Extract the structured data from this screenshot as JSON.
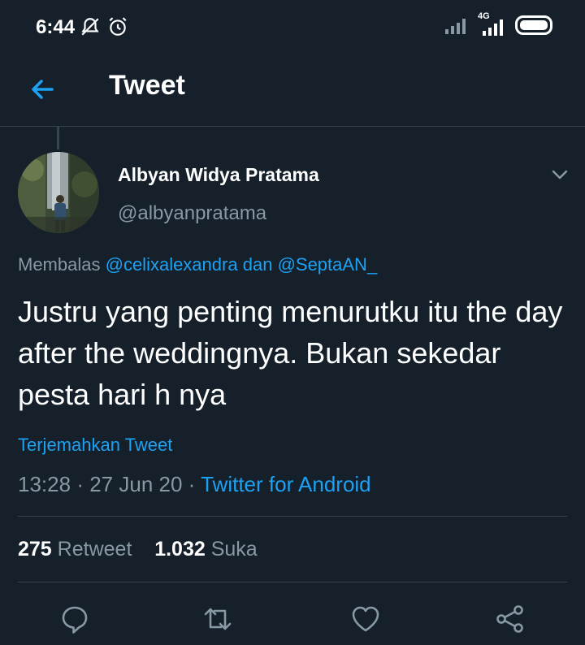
{
  "status_bar": {
    "time": "6:44",
    "network": "4G",
    "icons": [
      "silent-alarm-icon",
      "alarm-icon",
      "signal-icon",
      "signal-4g-icon",
      "battery-icon"
    ]
  },
  "header": {
    "back_icon": "arrow-left-icon",
    "title": "Tweet"
  },
  "tweet": {
    "author_name": "Albyan Widya Pratama",
    "author_handle": "@albyanpratama",
    "reply_prefix": "Membalas",
    "reply_user1": "@celixalexandra",
    "reply_conj": "dan",
    "reply_user2": "@SeptaAN_",
    "text": "Justru yang penting menurutku itu the day after the weddingnya. Bukan sekedar pesta hari h nya",
    "translate_label": "Terjemahkan Tweet",
    "time": "13:28",
    "date": "27 Jun 20",
    "source": "Twitter for Android",
    "retweet_count": "275",
    "retweet_label": "Retweet",
    "like_count": "1.032",
    "like_label": "Suka"
  },
  "actions": [
    "reply-icon",
    "retweet-icon",
    "like-icon",
    "share-icon"
  ],
  "colors": {
    "background": "#15202b",
    "accent": "#1da1f2",
    "muted": "#8899a6",
    "divider": "#38444d"
  }
}
